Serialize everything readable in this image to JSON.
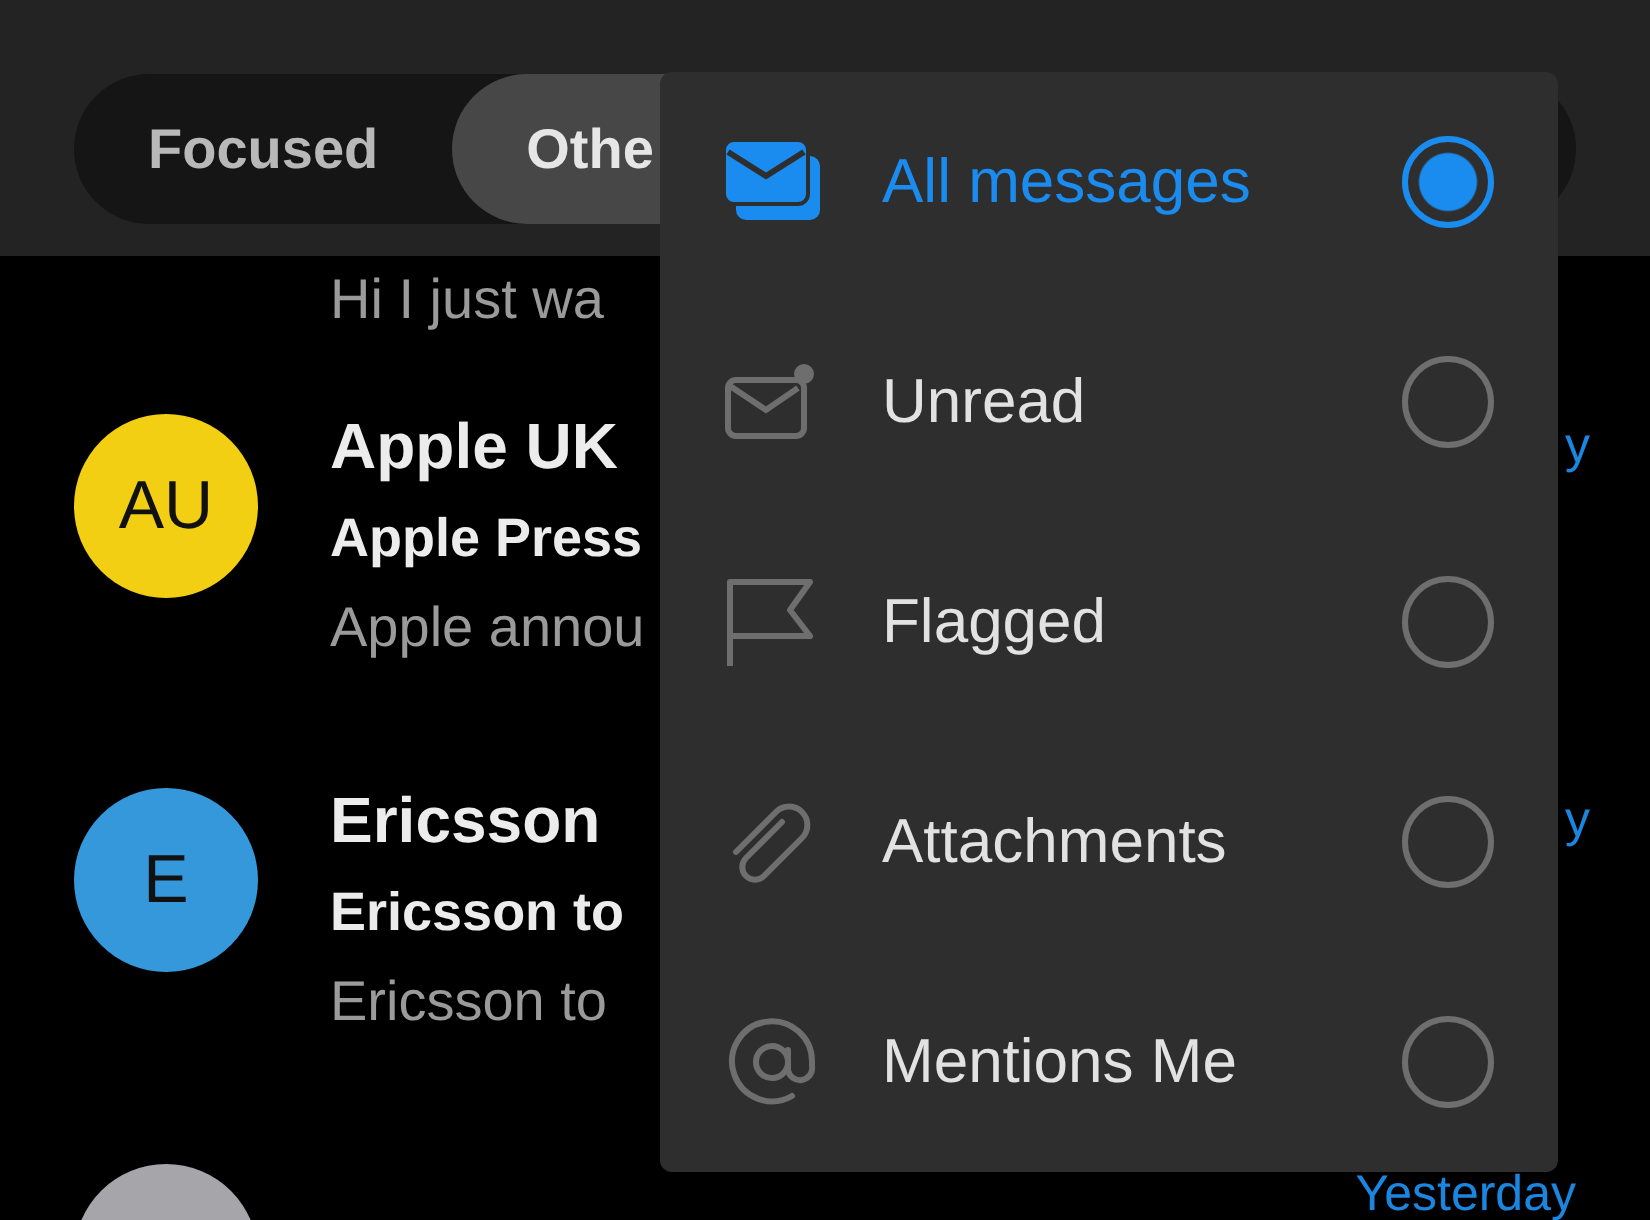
{
  "tabs": [
    {
      "label": "Focused",
      "selected": false
    },
    {
      "label": "Othe",
      "selected": true
    }
  ],
  "messages": [
    {
      "preview": "Hi I just wa"
    },
    {
      "sender": "Apple UK",
      "subject": "Apple Press",
      "preview": "Apple annou",
      "date": "y",
      "avatar": "AU",
      "color": "#f2cf13"
    },
    {
      "sender": "Ericsson",
      "subject": "Ericsson to",
      "preview": "Ericsson to",
      "date": "y",
      "avatar": "E",
      "color": "#3498db"
    },
    {
      "date": "Yesterday",
      "color": "#a6a6aa"
    }
  ],
  "filter_menu": [
    {
      "kind": "all",
      "label": "All messages",
      "selected": true
    },
    {
      "kind": "unread",
      "label": "Unread",
      "selected": false
    },
    {
      "kind": "flagged",
      "label": "Flagged",
      "selected": false
    },
    {
      "kind": "attachments",
      "label": "Attachments",
      "selected": false
    },
    {
      "kind": "mentions",
      "label": "Mentions Me",
      "selected": false
    }
  ]
}
